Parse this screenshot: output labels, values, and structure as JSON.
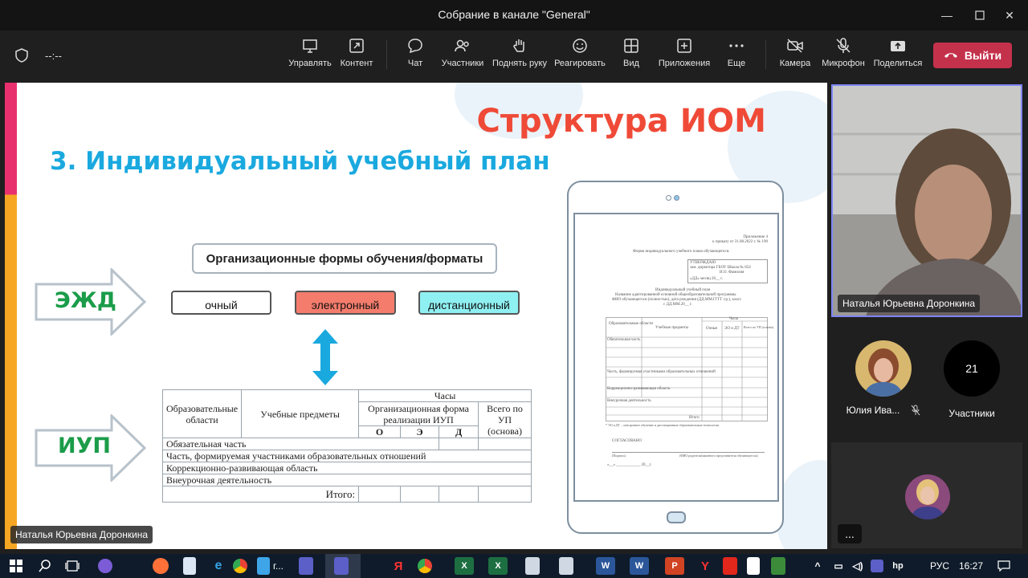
{
  "window": {
    "title": "Собрание в канале \"General\"",
    "timer": "--:--"
  },
  "toolbar": {
    "share_tray": "Управлять",
    "content": "Контент",
    "chat": "Чат",
    "people": "Участники",
    "raise_hand": "Поднять руку",
    "react": "Реагировать",
    "view": "Вид",
    "apps": "Приложения",
    "more": "Еще",
    "camera": "Камера",
    "mic": "Микрофон",
    "share": "Поделиться",
    "leave": "Выйти"
  },
  "slide": {
    "title": "Структура ИОМ",
    "subtitle": "3. Индивидуальный учебный план",
    "arrow_top": "ЭЖД",
    "arrow_bottom": "ИУП",
    "org_forms": "Организационные формы обучения/форматы",
    "pill_1": "очный",
    "pill_2": "электронный",
    "pill_3": "дистанционный",
    "table": {
      "col_areas": "Образовательные области",
      "col_subjects": "Учебные предметы",
      "col_hours": "Часы",
      "col_org_form": "Организационная форма реализации ИУП",
      "col_total": "Всего по УП (основа)",
      "sub_o": "О",
      "sub_e": "Э",
      "sub_d": "Д",
      "rows": [
        "Обязательная часть",
        "Часть, формируемая участниками образовательных отношений",
        "Коррекционно-развивающая область",
        "Внеурочная деятельность"
      ],
      "total": "Итого:"
    },
    "doc": {
      "l1": "Приложение 4",
      "l2": "к приказу от 31.08.2022 г. № 190",
      "l3": "Форма индивидуального учебного плана обучающегося.",
      "l4": "УТВЕРЖДАЮ",
      "l5": "зам. директора ГБОУ Школа № 854",
      "l6": "И.О. Фамилия",
      "l7": "«ДД» месяц 20__ г.",
      "l8": "Индивидуальный учебный план",
      "l9": "Название адаптированной основной общеобразовательной программы",
      "l10": "ФИО обучающегося (полностью), дата рождения (ДД.ММ.ГГГГ г.р.), класс",
      "l11": "с ДД.ММ.20__ г.",
      "h1": "Образовательные области",
      "h2": "Учебные предметы",
      "h3": "Часы",
      "h4": "Очные",
      "h5": "ЭО и ДТ",
      "h6": "Всего по УП (основа)",
      "r1": "Обязательная часть",
      "r2": "Часть, формируемая участниками образовательных отношений",
      "r3": "Коррекционно-развивающая область",
      "r4": "Внеурочная деятельность",
      "r5": "Итого",
      "foot": "* ЭО и ДТ – электронное обучение и дистанционные образовательные технологии",
      "agreed": "СОГЛАСОВАНО",
      "sign1": "(Подпись)",
      "sign2": "(ФИО родителя(законного представителя обучающегося)",
      "date": "«__» ____________ 20__г."
    }
  },
  "presenter_tag": "Наталья Юрьевна Доронкина",
  "main_video_tag": "Наталья Юрьевна Доронкина",
  "participants": {
    "p1_name": "Юлия Ива...",
    "count": "21",
    "count_label": "Участники",
    "more": "..."
  },
  "taskbar": {
    "app_label_1": "г...",
    "lang": "РУС",
    "time": "16:27"
  },
  "colors": {
    "accent": "#7f85f5",
    "leave": "#c4314b",
    "slide_title": "#ef4a37",
    "slide_subtitle": "#1aa9df",
    "arrow_text": "#1b9c4a",
    "pill_1": "#ffffff",
    "pill_2": "#f47c6c",
    "pill_3": "#8ff0f2"
  }
}
